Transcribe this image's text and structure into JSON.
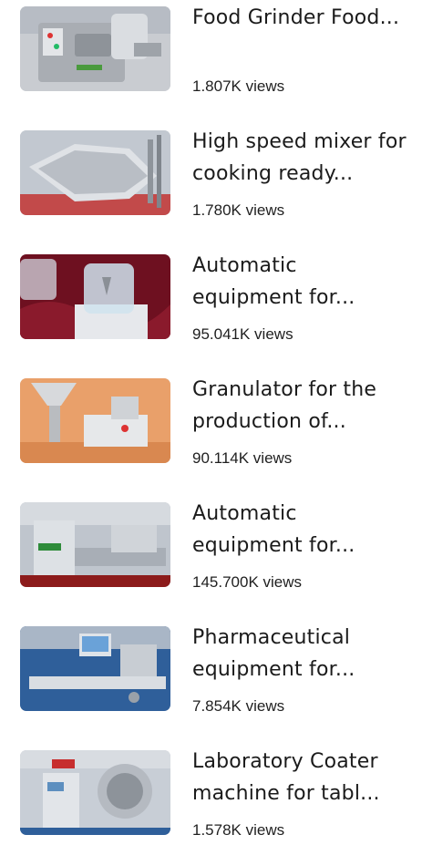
{
  "videos": [
    {
      "title": "Food Grinder Food...",
      "views": "1.807K views",
      "thumb": "food-grinder-thumbnail"
    },
    {
      "title": "High speed mixer for cooking ready...",
      "views": "1.780K views",
      "thumb": "mixer-thumbnail"
    },
    {
      "title": "Automatic equipment for...",
      "views": "95.041K views",
      "thumb": "automatic-equipment-thumbnail"
    },
    {
      "title": "Granulator for the production of...",
      "views": "90.114K views",
      "thumb": "granulator-thumbnail"
    },
    {
      "title": "Automatic equipment for...",
      "views": "145.700K views",
      "thumb": "production-line-thumbnail"
    },
    {
      "title": "Pharmaceutical equipment for...",
      "views": "7.854K views",
      "thumb": "pharmaceutical-line-thumbnail"
    },
    {
      "title": "Laboratory Coater machine for tabl...",
      "views": "1.578K views",
      "thumb": "lab-coater-thumbnail"
    }
  ]
}
